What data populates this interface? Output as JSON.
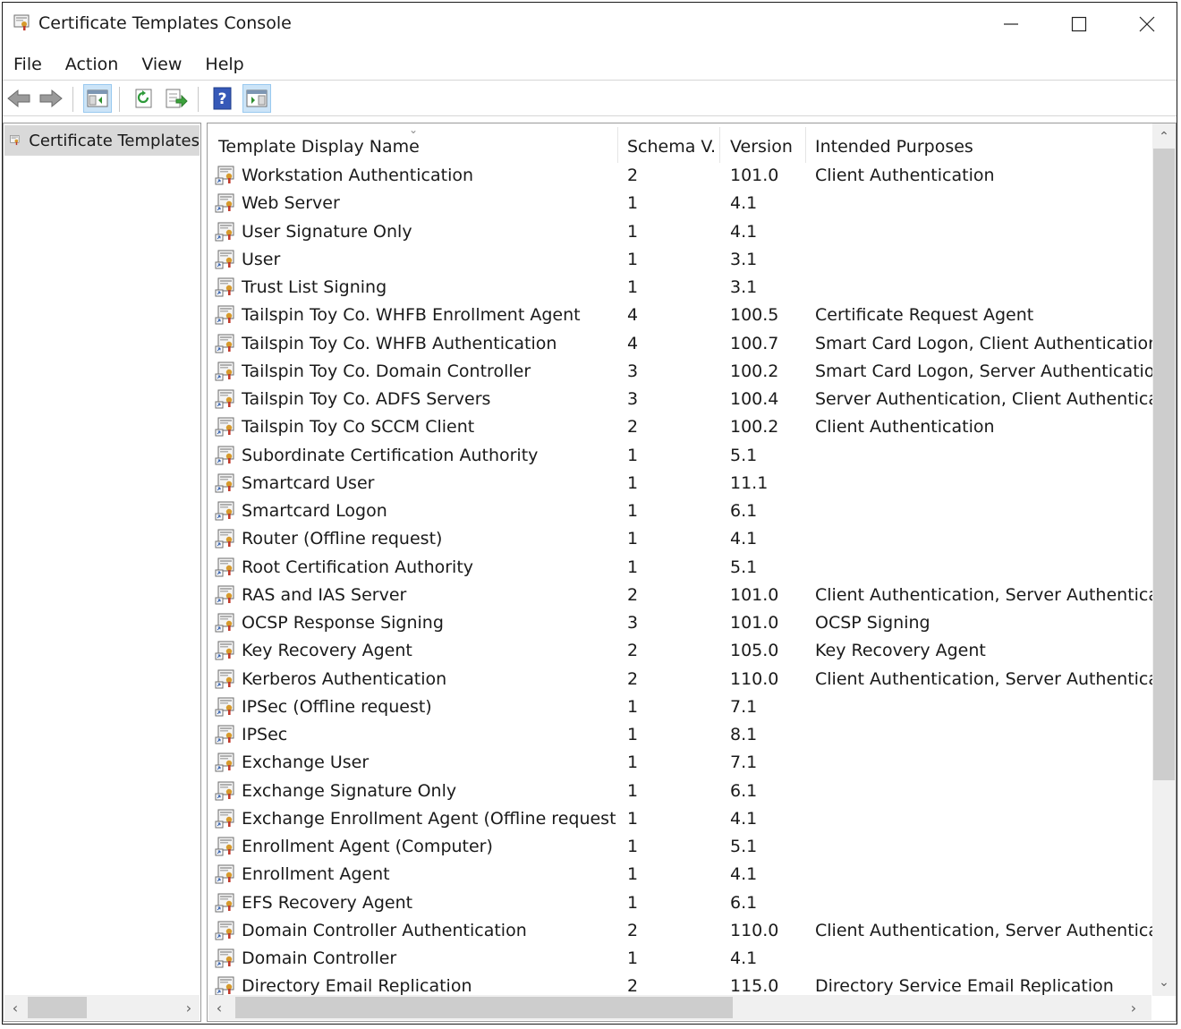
{
  "window": {
    "title": "Certificate Templates Console"
  },
  "menu": [
    "File",
    "Action",
    "View",
    "Help"
  ],
  "tree": {
    "selected_label": "Certificate Templates"
  },
  "columns": {
    "name": "Template Display Name",
    "schema": "Schema V...",
    "version": "Version",
    "purposes": "Intended Purposes"
  },
  "rows": [
    {
      "name": "Workstation Authentication",
      "schema": "2",
      "version": "101.0",
      "purposes": "Client Authentication"
    },
    {
      "name": "Web Server",
      "schema": "1",
      "version": "4.1",
      "purposes": ""
    },
    {
      "name": "User Signature Only",
      "schema": "1",
      "version": "4.1",
      "purposes": ""
    },
    {
      "name": "User",
      "schema": "1",
      "version": "3.1",
      "purposes": ""
    },
    {
      "name": "Trust List Signing",
      "schema": "1",
      "version": "3.1",
      "purposes": ""
    },
    {
      "name": "Tailspin Toy Co. WHFB Enrollment Agent",
      "schema": "4",
      "version": "100.5",
      "purposes": "Certificate Request Agent"
    },
    {
      "name": "Tailspin Toy Co. WHFB Authentication",
      "schema": "4",
      "version": "100.7",
      "purposes": "Smart Card Logon, Client Authentication"
    },
    {
      "name": "Tailspin Toy Co. Domain Controller",
      "schema": "3",
      "version": "100.2",
      "purposes": "Smart Card Logon, Server Authentication, KD"
    },
    {
      "name": "Tailspin Toy Co. ADFS Servers",
      "schema": "3",
      "version": "100.4",
      "purposes": "Server Authentication, Client Authentication"
    },
    {
      "name": "Tailspin Toy Co SCCM Client",
      "schema": "2",
      "version": "100.2",
      "purposes": "Client Authentication"
    },
    {
      "name": "Subordinate Certification Authority",
      "schema": "1",
      "version": "5.1",
      "purposes": ""
    },
    {
      "name": "Smartcard User",
      "schema": "1",
      "version": "11.1",
      "purposes": ""
    },
    {
      "name": "Smartcard Logon",
      "schema": "1",
      "version": "6.1",
      "purposes": ""
    },
    {
      "name": "Router (Offline request)",
      "schema": "1",
      "version": "4.1",
      "purposes": ""
    },
    {
      "name": "Root Certification Authority",
      "schema": "1",
      "version": "5.1",
      "purposes": ""
    },
    {
      "name": "RAS and IAS Server",
      "schema": "2",
      "version": "101.0",
      "purposes": "Client Authentication, Server Authentication"
    },
    {
      "name": "OCSP Response Signing",
      "schema": "3",
      "version": "101.0",
      "purposes": "OCSP Signing"
    },
    {
      "name": "Key Recovery Agent",
      "schema": "2",
      "version": "105.0",
      "purposes": "Key Recovery Agent"
    },
    {
      "name": "Kerberos Authentication",
      "schema": "2",
      "version": "110.0",
      "purposes": "Client Authentication, Server Authentication,"
    },
    {
      "name": "IPSec (Offline request)",
      "schema": "1",
      "version": "7.1",
      "purposes": ""
    },
    {
      "name": "IPSec",
      "schema": "1",
      "version": "8.1",
      "purposes": ""
    },
    {
      "name": "Exchange User",
      "schema": "1",
      "version": "7.1",
      "purposes": ""
    },
    {
      "name": "Exchange Signature Only",
      "schema": "1",
      "version": "6.1",
      "purposes": ""
    },
    {
      "name": "Exchange Enrollment Agent (Offline request)",
      "schema": "1",
      "version": "4.1",
      "purposes": ""
    },
    {
      "name": "Enrollment Agent (Computer)",
      "schema": "1",
      "version": "5.1",
      "purposes": ""
    },
    {
      "name": "Enrollment Agent",
      "schema": "1",
      "version": "4.1",
      "purposes": ""
    },
    {
      "name": "EFS Recovery Agent",
      "schema": "1",
      "version": "6.1",
      "purposes": ""
    },
    {
      "name": "Domain Controller Authentication",
      "schema": "2",
      "version": "110.0",
      "purposes": "Client Authentication, Server Authentication,"
    },
    {
      "name": "Domain Controller",
      "schema": "1",
      "version": "4.1",
      "purposes": ""
    },
    {
      "name": "Directory Email Replication",
      "schema": "2",
      "version": "115.0",
      "purposes": "Directory Service Email Replication"
    }
  ]
}
